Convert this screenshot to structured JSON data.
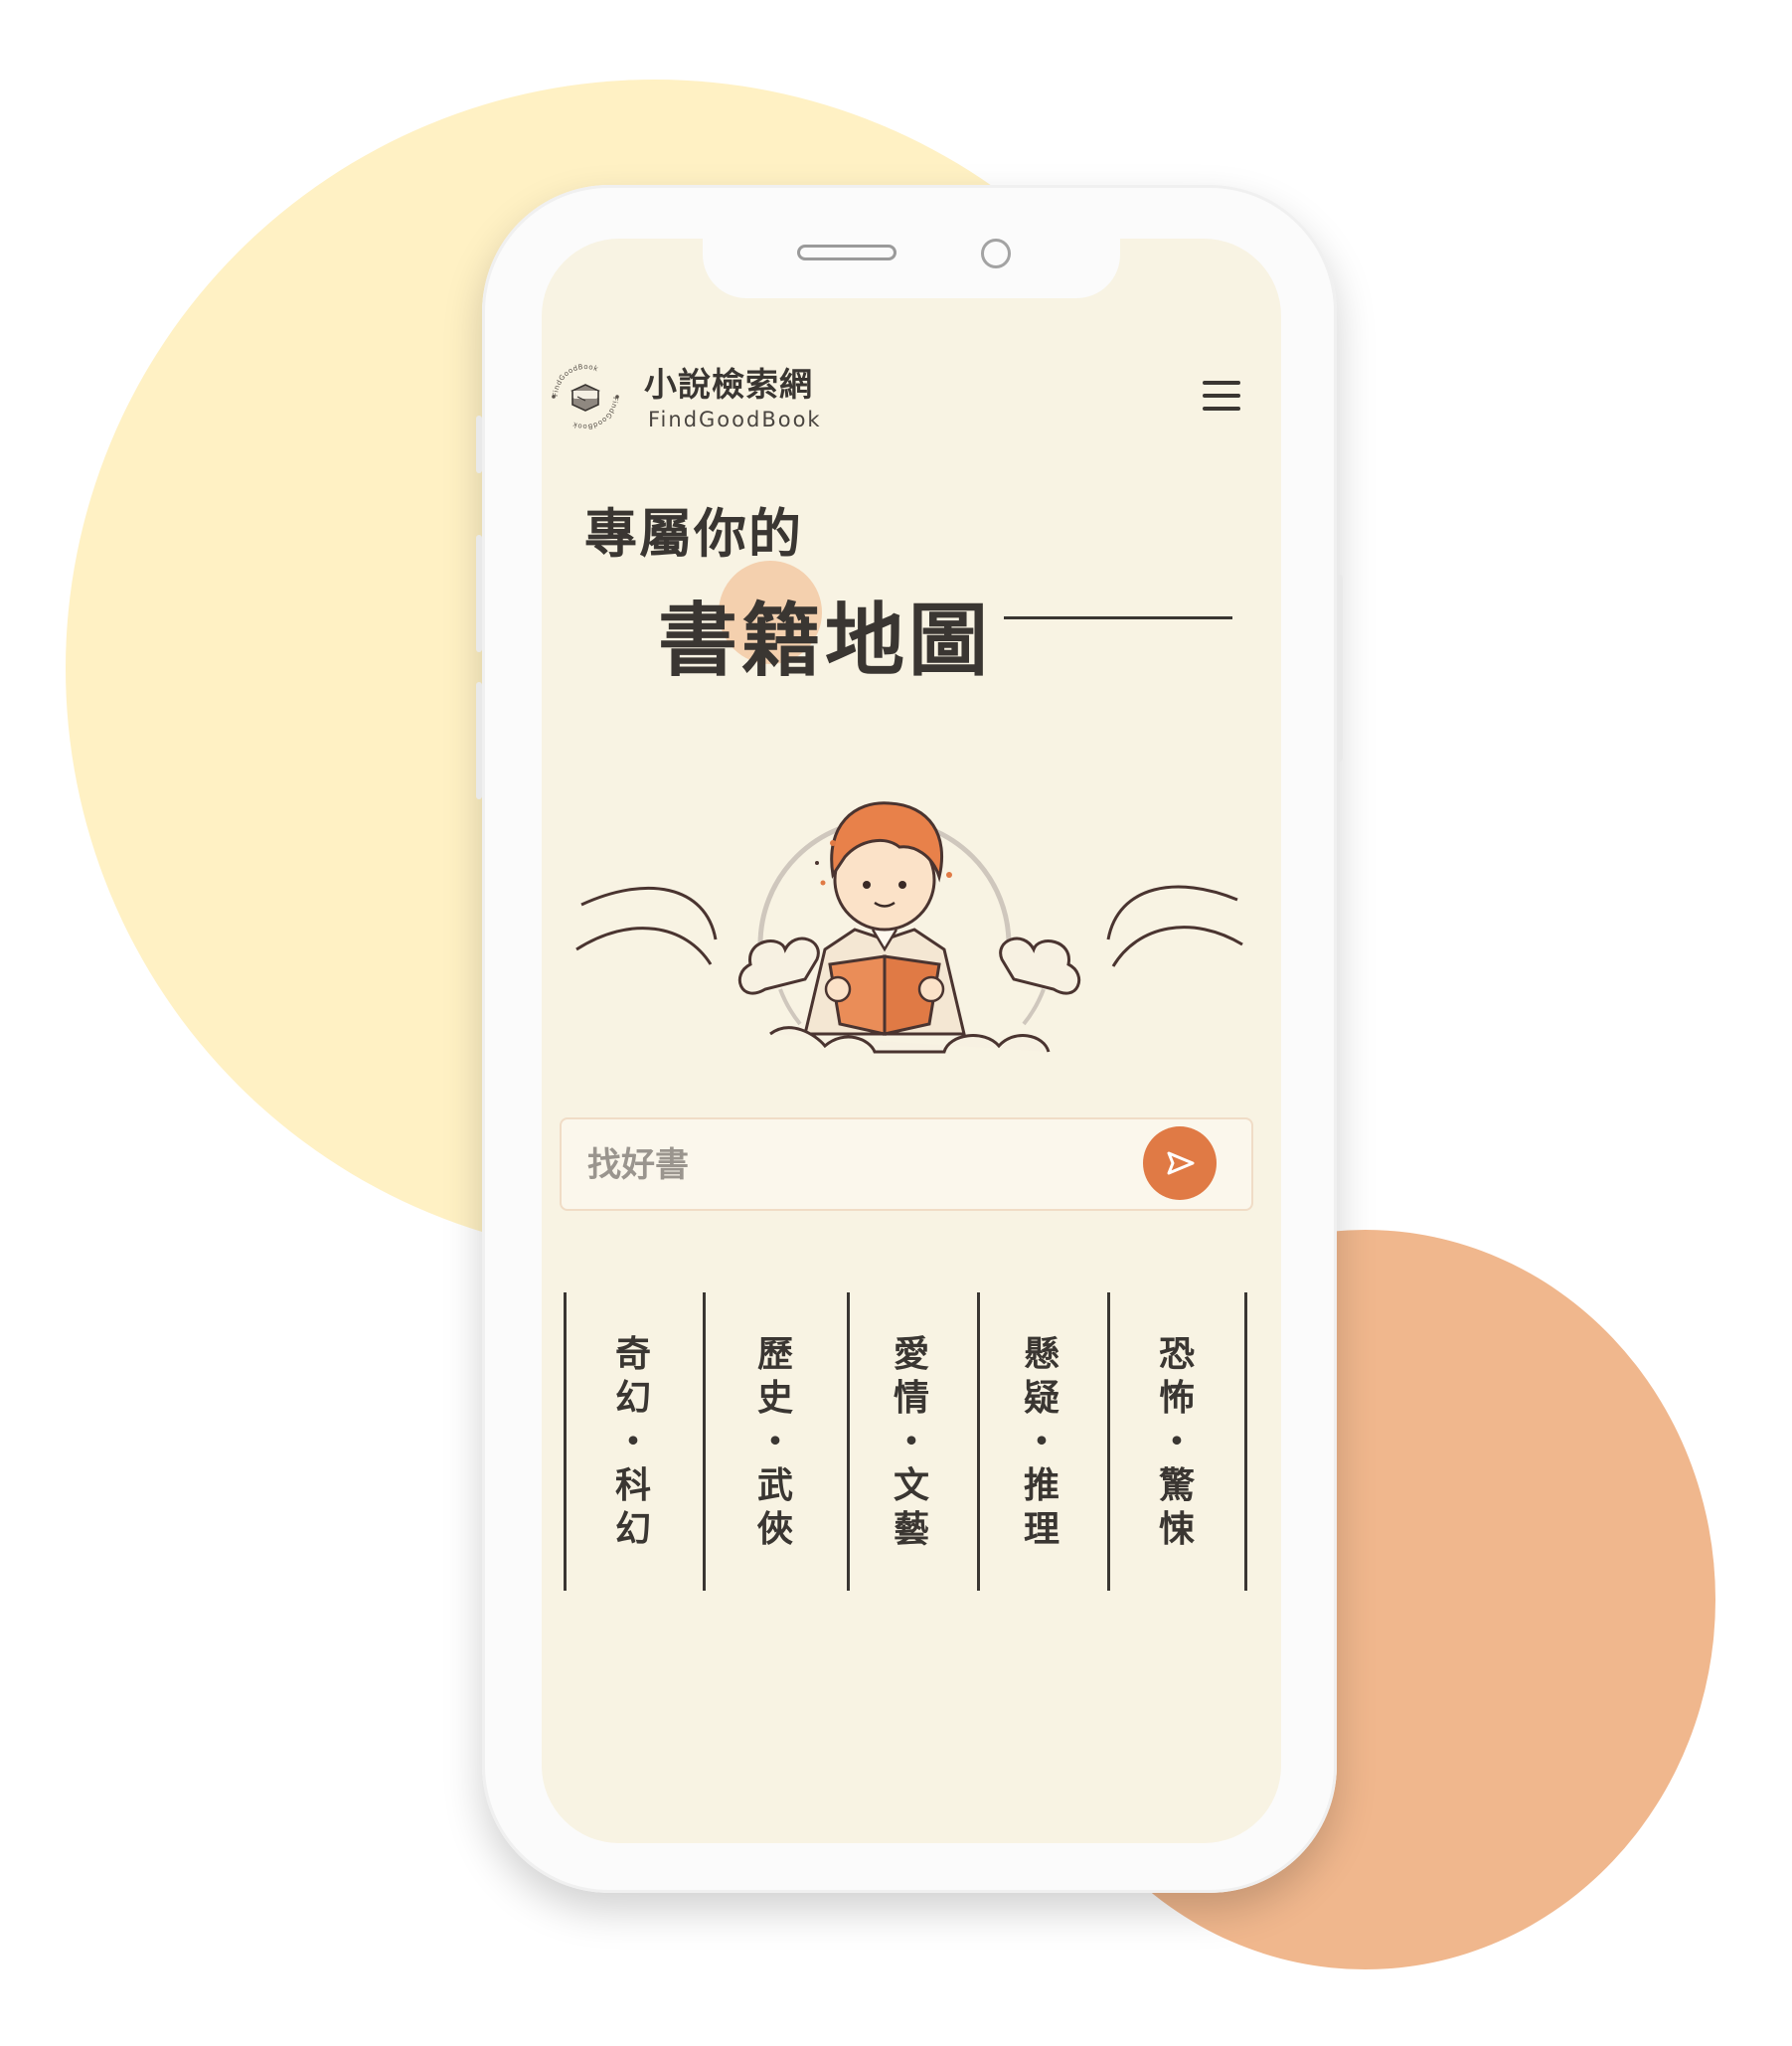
{
  "brand": {
    "name": "小說檢索網",
    "subtitle": "FindGoodBook",
    "logo_ring_text": "FindGoodBook"
  },
  "hero": {
    "line1": "專屬你的",
    "line2": "書籍地圖"
  },
  "search": {
    "placeholder": "找好書",
    "value": ""
  },
  "genres": [
    {
      "text": "奇幻・科幻",
      "chars": [
        "奇",
        "幻",
        "・",
        "科",
        "幻"
      ]
    },
    {
      "text": "歷史・武俠",
      "chars": [
        "歷",
        "史",
        "・",
        "武",
        "俠"
      ]
    },
    {
      "text": "愛情・文藝",
      "chars": [
        "愛",
        "情",
        "・",
        "文",
        "藝"
      ]
    },
    {
      "text": "懸疑・推理",
      "chars": [
        "懸",
        "疑",
        "・",
        "推",
        "理"
      ]
    },
    {
      "text": "恐怖・驚悚",
      "chars": [
        "恐",
        "怖",
        "・",
        "驚",
        "悚"
      ]
    }
  ],
  "icons": {
    "menu": "hamburger-menu-icon",
    "send": "send-arrow-icon",
    "logo": "book-stack-logo-icon"
  },
  "colors": {
    "accent": "#e07a45",
    "screen_bg": "#f8f3e3",
    "text": "#3a3632",
    "bg_yellow": "#fff1c4",
    "bg_orange": "#f0b78d"
  }
}
